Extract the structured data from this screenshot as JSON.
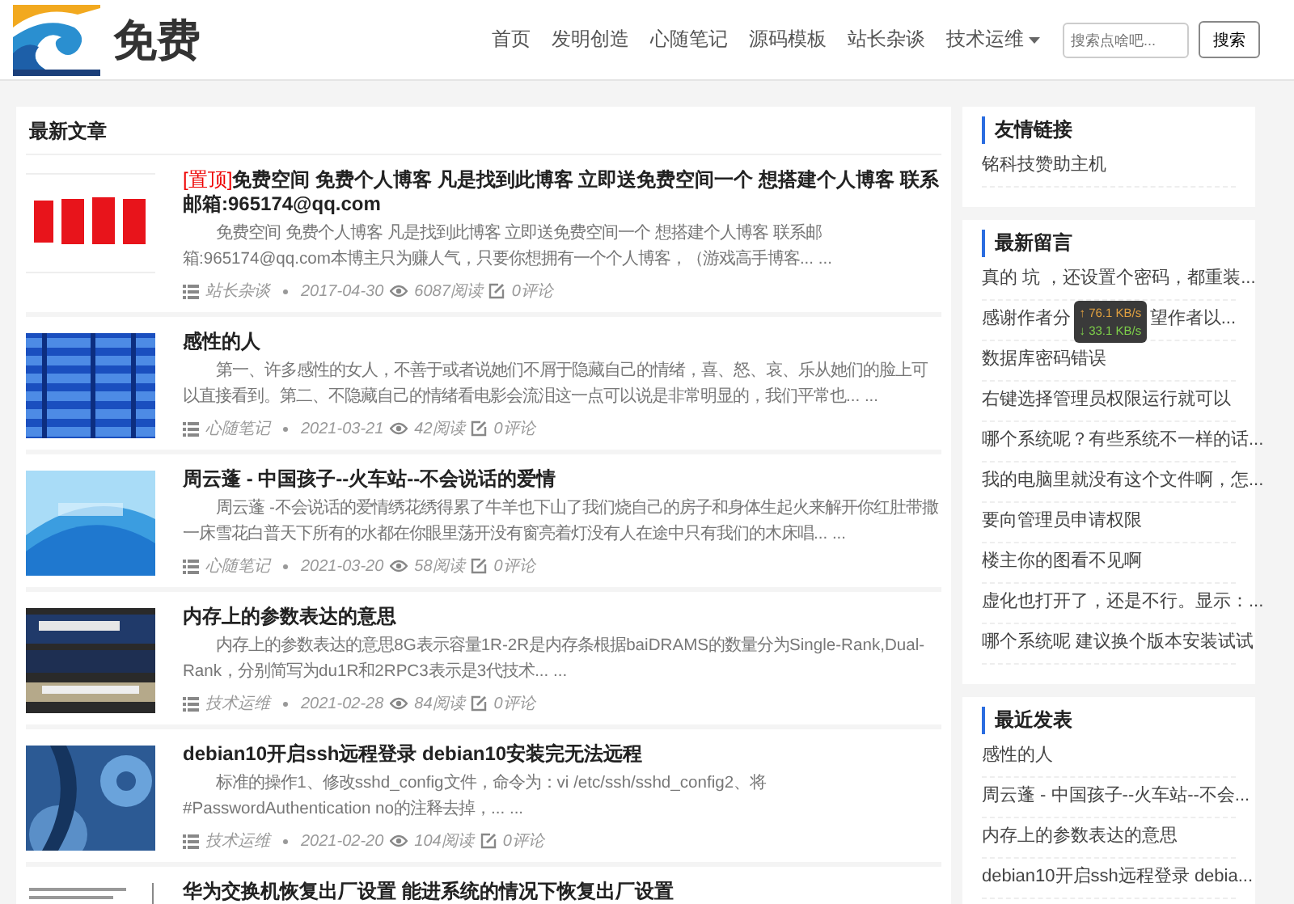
{
  "header": {
    "logo_text": "免费",
    "nav": [
      {
        "label": "首页",
        "dropdown": false
      },
      {
        "label": "发明创造",
        "dropdown": false
      },
      {
        "label": "心随笔记",
        "dropdown": false
      },
      {
        "label": "源码模板",
        "dropdown": false
      },
      {
        "label": "站长杂谈",
        "dropdown": false
      },
      {
        "label": "技术运维",
        "dropdown": true
      }
    ],
    "search": {
      "placeholder": "搜索点啥吧...",
      "button": "搜索"
    }
  },
  "main": {
    "title": "最新文章",
    "articles": [
      {
        "kind": "picture",
        "tag": "[置顶]",
        "title": "免费空间 免费个人博客 凡是找到此博客 立即送免费空间一个 想搭建个人博客 联系邮箱:965174@qq.com",
        "excerpt": "免费空间 免费个人博客 凡是找到此博客 立即送免费空间一个 想搭建个人博客 联系邮箱:965174@qq.com本博主只为赚人气，只要你想拥有一个个人博客，（游戏高手博客... ...",
        "category": "站长杂谈",
        "date": "2017-04-30",
        "views": "6087阅读",
        "comments": "0评论"
      },
      {
        "kind": "picture",
        "title": "感性的人",
        "excerpt": "第一、许多感性的女人，不善于或者说她们不屑于隐藏自己的情绪，喜、怒、哀、乐从她们的脸上可以直接看到。第二、不隐藏自己的情绪看电影会流泪这一点可以说是非常明显的，我们平常也... ...",
        "category": "心随笔记",
        "date": "2021-03-21",
        "views": "42阅读",
        "comments": "0评论"
      },
      {
        "kind": "picture",
        "title": "周云蓬 - 中国孩子--火车站--不会说话的爱情",
        "excerpt": "周云蓬 -不会说话的爱情绣花绣得累了牛羊也下山了我们烧自己的房子和身体生起火来解开你红肚带撒一床雪花白普天下所有的水都在你眼里荡开没有窗亮着灯没有人在途中只有我们的木床唱... ...",
        "category": "心随笔记",
        "date": "2021-03-20",
        "views": "58阅读",
        "comments": "0评论"
      },
      {
        "kind": "picture",
        "title": "内存上的参数表达的意思",
        "excerpt": "内存上的参数表达的意思8G表示容量1R-2R是内存条根据baiDRAMS的数量分为Single-Rank,Dual-Rank，分别简写为du1R和2RPC3表示是3代技术... ...",
        "category": "技术运维",
        "date": "2021-02-28",
        "views": "84阅读",
        "comments": "0评论"
      },
      {
        "kind": "picture",
        "title": "debian10开启ssh远程登录 debian10安装完无法远程",
        "excerpt": "标准的操作1、修改sshd_config文件，命令为：vi /etc/ssh/sshd_config2、将#PasswordAuthentication no的注释去掉，... ...",
        "category": "技术运维",
        "date": "2021-02-20",
        "views": "104阅读",
        "comments": "0评论"
      },
      {
        "kind": "picture",
        "title": "华为交换机恢复出厂设置 能进系统的情况下恢复出厂设置"
      }
    ]
  },
  "sidebar": [
    {
      "title": "友情链接",
      "items": [
        {
          "text": "铭科技赞助主机"
        }
      ]
    },
    {
      "title": "最新留言",
      "items": [
        {
          "text": "真的 坑 ，还设置个密码，都重装..."
        },
        {
          "text": "感谢作者分",
          "text_after": "望作者以...",
          "overlay": {
            "up": "↑ 76.1 KB/s",
            "down": "↓ 33.1 KB/s"
          }
        },
        {
          "text": "数据库密码错误"
        },
        {
          "text": "右键选择管理员权限运行就可以"
        },
        {
          "text": "哪个系统呢？有些系统不一样的话..."
        },
        {
          "text": "我的电脑里就没有这个文件啊，怎..."
        },
        {
          "text": "要向管理员申请权限"
        },
        {
          "text": "楼主你的图看不见啊"
        },
        {
          "text": "虚化也打开了，还是不行。显示：..."
        },
        {
          "text": "哪个系统呢 建议换个版本安装试试"
        }
      ]
    },
    {
      "title": "最近发表",
      "items": [
        {
          "text": "感性的人"
        },
        {
          "text": "周云蓬 - 中国孩子--火车站--不会..."
        },
        {
          "text": "内存上的参数表达的意思"
        },
        {
          "text": "debian10开启ssh远程登录 debia..."
        }
      ]
    }
  ]
}
